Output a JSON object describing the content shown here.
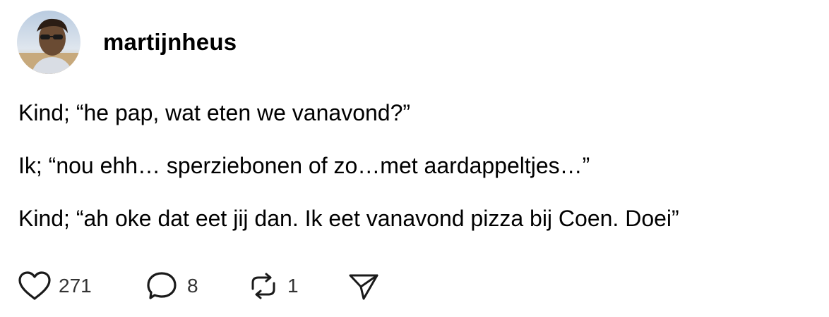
{
  "post": {
    "username": "martijnheus",
    "lines": [
      "Kind; “he pap, wat eten we vanavond?”",
      "Ik; “nou ehh… sperziebonen of zo…met aardappeltjes…”",
      "Kind; “ah oke dat eet jij dan. Ik eet vanavond pizza bij Coen. Doei”"
    ]
  },
  "actions": {
    "like": {
      "icon": "heart-icon",
      "count": "271"
    },
    "reply": {
      "icon": "speech-bubble-icon",
      "count": "8"
    },
    "repost": {
      "icon": "repost-icon",
      "count": "1"
    },
    "share": {
      "icon": "send-icon"
    }
  },
  "colors": {
    "text": "#000000",
    "count": "#333333",
    "background": "#ffffff"
  }
}
